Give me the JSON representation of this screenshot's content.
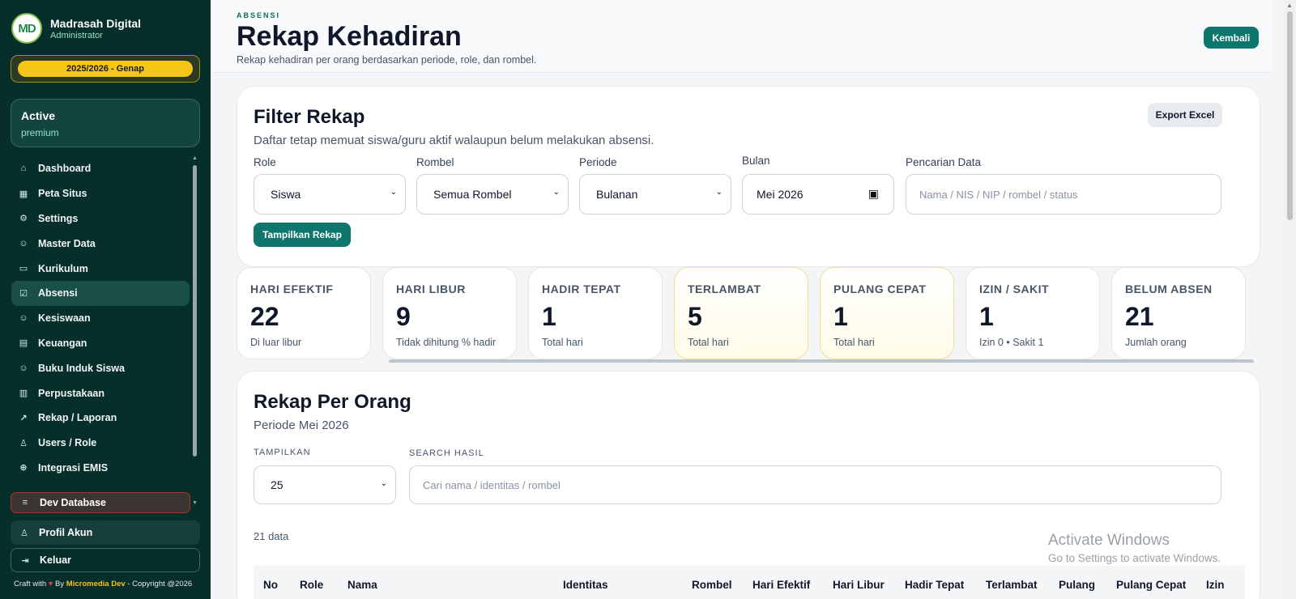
{
  "sidebar": {
    "logo_text": "MD",
    "brand_title": "Madrasah Digital",
    "brand_sub": "Administrator",
    "year": "2025/2026 - Genap",
    "status_title": "Active",
    "status_sub": "premium",
    "items": [
      {
        "label": "Dashboard",
        "icon": "home-icon"
      },
      {
        "label": "Peta Situs",
        "icon": "grid-icon"
      },
      {
        "label": "Settings",
        "icon": "gear-icon"
      },
      {
        "label": "Master Data",
        "icon": "users-icon"
      },
      {
        "label": "Kurikulum",
        "icon": "calendar-icon"
      },
      {
        "label": "Absensi",
        "icon": "check-square-icon"
      },
      {
        "label": "Kesiswaan",
        "icon": "users-icon"
      },
      {
        "label": "Keuangan",
        "icon": "card-icon"
      },
      {
        "label": "Buku Induk Siswa",
        "icon": "users-icon"
      },
      {
        "label": "Perpustakaan",
        "icon": "book-icon"
      },
      {
        "label": "Rekap / Laporan",
        "icon": "chart-icon"
      },
      {
        "label": "Users / Role",
        "icon": "user-icon"
      },
      {
        "label": "Integrasi EMIS",
        "icon": "plus-circle-icon"
      }
    ],
    "active_index": 5,
    "dev_db": "Dev Database",
    "profil": "Profil Akun",
    "keluar": "Keluar",
    "footer_pre": "Craft with",
    "footer_by": "By",
    "footer_dev": "Micromedia Dev",
    "footer_post": "- Copyright @2026"
  },
  "header": {
    "eyebrow": "ABSENSI",
    "title": "Rekap Kehadiran",
    "desc": "Rekap kehadiran per orang berdasarkan periode, role, dan rombel.",
    "back_label": "Kembali"
  },
  "filter": {
    "title": "Filter Rekap",
    "desc": "Daftar tetap memuat siswa/guru aktif walaupun belum melakukan absensi.",
    "export_label": "Export Excel",
    "role_label": "Role",
    "role_value": "Siswa",
    "rombel_label": "Rombel",
    "rombel_value": "Semua Rombel",
    "periode_label": "Periode",
    "periode_value": "Bulanan",
    "bulan_label": "Bulan",
    "bulan_value": "Mei 2026",
    "search_label": "Pencarian Data",
    "search_placeholder": "Nama / NIS / NIP / rombel / status",
    "submit_label": "Tampilkan Rekap"
  },
  "stats": [
    {
      "label": "HARI EFEKTIF",
      "value": "22",
      "note": "Di luar libur"
    },
    {
      "label": "HARI LIBUR",
      "value": "9",
      "note": "Tidak dihitung % hadir"
    },
    {
      "label": "HADIR TEPAT",
      "value": "1",
      "note": "Total hari"
    },
    {
      "label": "TERLAMBAT",
      "value": "5",
      "note": "Total hari"
    },
    {
      "label": "PULANG CEPAT",
      "value": "1",
      "note": "Total hari"
    },
    {
      "label": "IZIN / SAKIT",
      "value": "1",
      "note": "Izin 0 • Sakit 1"
    },
    {
      "label": "BELUM ABSEN",
      "value": "21",
      "note": "Jumlah orang"
    }
  ],
  "rekap": {
    "title": "Rekap Per Orang",
    "periode": "Periode Mei 2026",
    "show_label": "TAMPILKAN",
    "show_value": "25",
    "search_label": "SEARCH HASIL",
    "search_placeholder": "Cari nama / identitas / rombel",
    "count": "21 data",
    "columns": [
      "No",
      "Role",
      "Nama",
      "Identitas",
      "Rombel",
      "Hari Efektif",
      "Hari Libur",
      "Hadir Tepat",
      "Terlambat",
      "Pulang",
      "Pulang Cepat",
      "Izin"
    ]
  },
  "watermark": {
    "line1": "Activate Windows",
    "line2": "Go to Settings to activate Windows."
  },
  "colors": {
    "sidebar_bg": "#062e2b",
    "accent": "#0f766e",
    "year_pill": "#f5c518"
  }
}
